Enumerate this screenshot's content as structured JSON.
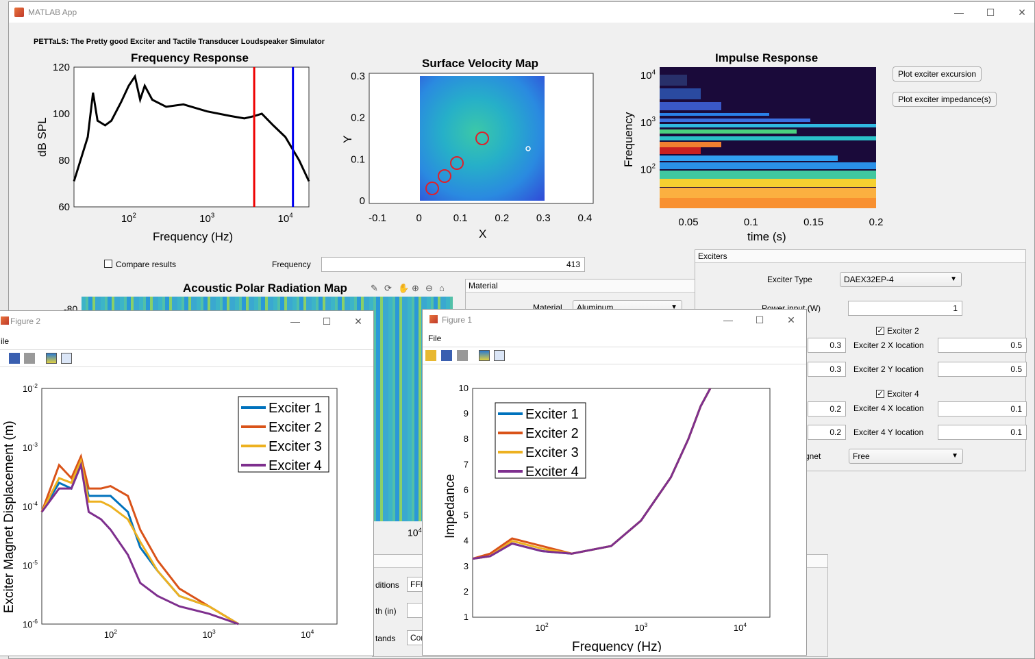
{
  "app": {
    "window_title": "MATLAB App",
    "heading": "PETTaLS: The Pretty good Exciter and Tactile Transducer Loudspeaker Simulator",
    "freq_plot": {
      "title": "Frequency Response",
      "ylabel": "dB SPL",
      "xlabel": "Frequency (Hz)",
      "yticks": [
        "120",
        "100",
        "80",
        "60"
      ],
      "xticks": [
        "10",
        "10",
        "10"
      ],
      "xtick_exps": [
        "2",
        "3",
        "4"
      ]
    },
    "velocity_plot": {
      "title": "Surface Velocity Map",
      "xlabel": "X",
      "ylabel": "Y",
      "xticks": [
        "-0.1",
        "0",
        "0.1",
        "0.2",
        "0.3",
        "0.4"
      ],
      "yticks": [
        "0.3",
        "0.2",
        "0.1",
        "0"
      ]
    },
    "impulse_plot": {
      "title": "Impulse Response",
      "xlabel": "time (s)",
      "ylabel": "Frequency",
      "xticks": [
        "0.05",
        "0.1",
        "0.15",
        "0.2"
      ],
      "yticks": [
        "10",
        "10",
        "10"
      ],
      "ytick_exps": [
        "4",
        "3",
        "2"
      ]
    },
    "buttons": {
      "plot_excursion": "Plot exciter excursion",
      "plot_impedance": "Plot exciter impedance(s)"
    },
    "compare_results": "Compare results",
    "frequency_label": "Frequency",
    "frequency_value": "413",
    "polar_title": "Acoustic Polar Radiation Map",
    "polar_ytick": "-80",
    "polar_xtick": "10",
    "polar_xtick_exp": "4",
    "material_panel": {
      "title": "Material",
      "material_label": "Material",
      "material_value": "Aluminum"
    },
    "exciters_panel": {
      "title": "Exciters",
      "exciter_type_label": "Exciter Type",
      "exciter_type_value": "DAEX32EP-4",
      "power_label": "Power input (W)",
      "power_value": "1",
      "exciter2_label": "Exciter 2",
      "exciter2_x_label": "Exciter 2 X location",
      "exciter2_x_value": "0.5",
      "exciter2_y_label": "Exciter 2 Y location",
      "exciter2_y_value": "0.5",
      "left_x_value": "0.3",
      "left_y_value": "0.3",
      "exciter4_label": "Exciter 4",
      "exciter4_x_label": "Exciter 4 X location",
      "exciter4_x_value": "0.1",
      "exciter4_y_label": "Exciter 4 Y location",
      "exciter4_y_value": "0.1",
      "left_x3_value": "0.2",
      "left_y3_value": "0.2",
      "magnet_label": "gnet",
      "magnet_value": "Free"
    },
    "bottom_panel": {
      "conditions_label": "ditions",
      "conditions_value": "FFF",
      "depth_label": "th (in)",
      "stands_label": "tands",
      "stands_value": "Cor"
    }
  },
  "figure2": {
    "title": "Figure 2",
    "menu_file": "ile",
    "ylabel": "Exciter Magnet Displacement (m)",
    "yticks": [
      "10",
      "10",
      "10",
      "10",
      "10"
    ],
    "ytick_exps": [
      "-2",
      "-3",
      "-4",
      "-5",
      "-6"
    ],
    "xticks": [
      "10",
      "10",
      "10"
    ],
    "xtick_exps": [
      "2",
      "3",
      "4"
    ],
    "legend": [
      "Exciter 1",
      "Exciter 2",
      "Exciter 3",
      "Exciter 4"
    ]
  },
  "figure1": {
    "title": "Figure 1",
    "menu_file": "File",
    "ylabel": "Impedance",
    "xlabel": "Frequency (Hz)",
    "yticks": [
      "10",
      "9",
      "8",
      "7",
      "6",
      "5",
      "4",
      "3",
      "2",
      "1"
    ],
    "xticks": [
      "10",
      "10",
      "10"
    ],
    "xtick_exps": [
      "2",
      "3",
      "4"
    ],
    "legend": [
      "Exciter 1",
      "Exciter 2",
      "Exciter 3",
      "Exciter 4"
    ]
  },
  "series_colors": [
    "#0072bd",
    "#d95319",
    "#edb120",
    "#7e2f8e"
  ],
  "chart_data": [
    {
      "type": "line",
      "title": "Frequency Response",
      "xlabel": "Frequency (Hz)",
      "ylabel": "dB SPL",
      "xscale": "log",
      "xlim": [
        20,
        20000
      ],
      "ylim": [
        60,
        120
      ],
      "x": [
        20,
        30,
        35,
        40,
        50,
        60,
        80,
        100,
        120,
        140,
        160,
        200,
        300,
        500,
        1000,
        2000,
        3000,
        4000,
        5000,
        7000,
        10000,
        15000,
        20000
      ],
      "y": [
        71,
        90,
        109,
        97,
        95,
        97,
        105,
        112,
        116,
        106,
        112,
        106,
        103,
        104,
        101,
        99,
        98,
        99,
        100,
        95,
        90,
        80,
        71
      ],
      "markers": [
        {
          "x": 4000,
          "color": "red"
        },
        {
          "x": 12500,
          "color": "blue"
        }
      ]
    },
    {
      "type": "line",
      "title": "Impedance",
      "xscale": "log",
      "xlim": [
        20,
        20000
      ],
      "ylim": [
        1,
        10
      ],
      "series": [
        {
          "name": "Exciter 1",
          "x": [
            20,
            30,
            50,
            100,
            200,
            500,
            1000,
            2000,
            3000,
            4000,
            5000
          ],
          "y": [
            3.3,
            3.4,
            3.9,
            3.6,
            3.5,
            3.8,
            4.8,
            6.5,
            8.0,
            9.3,
            10
          ]
        },
        {
          "name": "Exciter 2",
          "x": [
            20,
            30,
            50,
            100,
            200,
            500,
            1000,
            2000,
            3000,
            4000,
            5000
          ],
          "y": [
            3.3,
            3.5,
            4.1,
            3.8,
            3.5,
            3.8,
            4.8,
            6.5,
            8.0,
            9.3,
            10
          ]
        },
        {
          "name": "Exciter 3",
          "x": [
            20,
            30,
            50,
            100,
            200,
            500,
            1000,
            2000,
            3000,
            4000,
            5000
          ],
          "y": [
            3.3,
            3.4,
            4.0,
            3.7,
            3.5,
            3.8,
            4.8,
            6.5,
            8.0,
            9.3,
            10
          ]
        },
        {
          "name": "Exciter 4",
          "x": [
            20,
            30,
            50,
            100,
            200,
            500,
            1000,
            2000,
            3000,
            4000,
            5000
          ],
          "y": [
            3.3,
            3.4,
            3.9,
            3.6,
            3.5,
            3.8,
            4.8,
            6.5,
            8.0,
            9.3,
            10
          ]
        }
      ]
    },
    {
      "type": "line",
      "title": "Exciter Magnet Displacement",
      "xscale": "log",
      "yscale": "log",
      "xlim": [
        20,
        20000
      ],
      "ylim": [
        1e-06,
        0.01
      ],
      "series": [
        {
          "name": "Exciter 1",
          "x": [
            20,
            30,
            40,
            50,
            60,
            80,
            100,
            150,
            200,
            300,
            500,
            1000,
            2000
          ],
          "y": [
            8e-05,
            0.00025,
            0.0002,
            0.0005,
            0.00015,
            0.00015,
            0.00015,
            8e-05,
            2e-05,
            8e-06,
            3e-06,
            2e-06,
            1e-06
          ]
        },
        {
          "name": "Exciter 2",
          "x": [
            20,
            30,
            40,
            50,
            60,
            80,
            100,
            150,
            200,
            300,
            500,
            1000,
            2000
          ],
          "y": [
            8e-05,
            0.0005,
            0.0003,
            0.0007,
            0.0002,
            0.0002,
            0.00022,
            0.00015,
            4e-05,
            1.2e-05,
            4e-06,
            2e-06,
            1e-06
          ]
        },
        {
          "name": "Exciter 3",
          "x": [
            20,
            30,
            40,
            50,
            60,
            80,
            100,
            150,
            200,
            300,
            500,
            1000,
            2000
          ],
          "y": [
            8e-05,
            0.0003,
            0.00025,
            0.0006,
            0.00012,
            0.00012,
            0.0001,
            6e-05,
            2.5e-05,
            8e-06,
            3e-06,
            2e-06,
            1e-06
          ]
        },
        {
          "name": "Exciter 4",
          "x": [
            20,
            30,
            40,
            50,
            60,
            80,
            100,
            150,
            200,
            300,
            500,
            1000,
            2000
          ],
          "y": [
            8e-05,
            0.0002,
            0.0002,
            0.0005,
            8e-05,
            6e-05,
            4e-05,
            1.5e-05,
            5e-06,
            3e-06,
            2e-06,
            1.5e-06,
            1e-06
          ]
        }
      ]
    }
  ]
}
